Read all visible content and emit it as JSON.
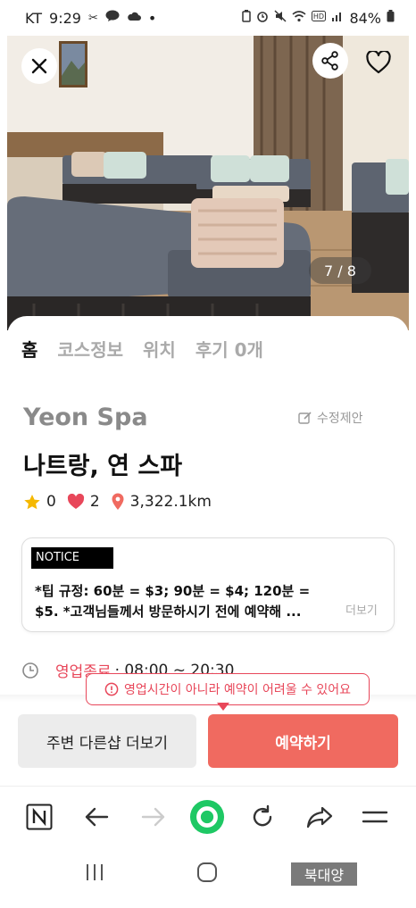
{
  "status_bar": {
    "carrier": "KT",
    "time": "9:29",
    "dot": "•",
    "battery": "84%",
    "left_icons": [
      "scissors-icon",
      "chat-icon",
      "cloud-icon"
    ],
    "right_icons": [
      "battery-saver-icon",
      "alarm-icon",
      "mute-icon",
      "wifi-icon",
      "hd-icon",
      "signal-icon",
      "battery-icon"
    ]
  },
  "hero": {
    "counter": "7 / 8",
    "close_icon": "close-icon",
    "share_icon": "share-icon",
    "heart_icon": "heart-outline-icon"
  },
  "tabs": [
    {
      "label": "홈",
      "active": true
    },
    {
      "label": "코스정보",
      "active": false
    },
    {
      "label": "위치",
      "active": false
    },
    {
      "label": "후기 0개",
      "active": false
    }
  ],
  "shop": {
    "name_en": "Yeon Spa",
    "name_ko": "나트랑, 연 스파",
    "suggest_label": "수정제안"
  },
  "stats": {
    "rating": "0",
    "likes": "2",
    "distance": "3,322.1km"
  },
  "notice": {
    "tag": "NOTICE",
    "line1": "*팁 규정: 60분 = $3; 90분 = $4; 120분 =",
    "line2": "$5. *고객님들께서 방문하시기 전에 예약해 ...",
    "more": "더보기"
  },
  "hours": {
    "status": "영업종료",
    "time": "· 08:00 ~ 20:30"
  },
  "tooltip": {
    "text": "영업시간이 아니라 예약이 어려울 수 있어요"
  },
  "actions": {
    "other_shops": "주변 다른샵 더보기",
    "reserve": "예약하기"
  },
  "browser": {
    "icons": [
      "naver-icon",
      "back-arrow-icon",
      "forward-arrow-icon",
      "green-dot-icon",
      "refresh-icon",
      "share-arrow-icon",
      "menu-icon"
    ]
  },
  "watermark": "북대양",
  "colors": {
    "accent": "#f06a60",
    "warning": "#e8475a",
    "tab_highlight": "#ffe14d",
    "green": "#1ec864"
  }
}
